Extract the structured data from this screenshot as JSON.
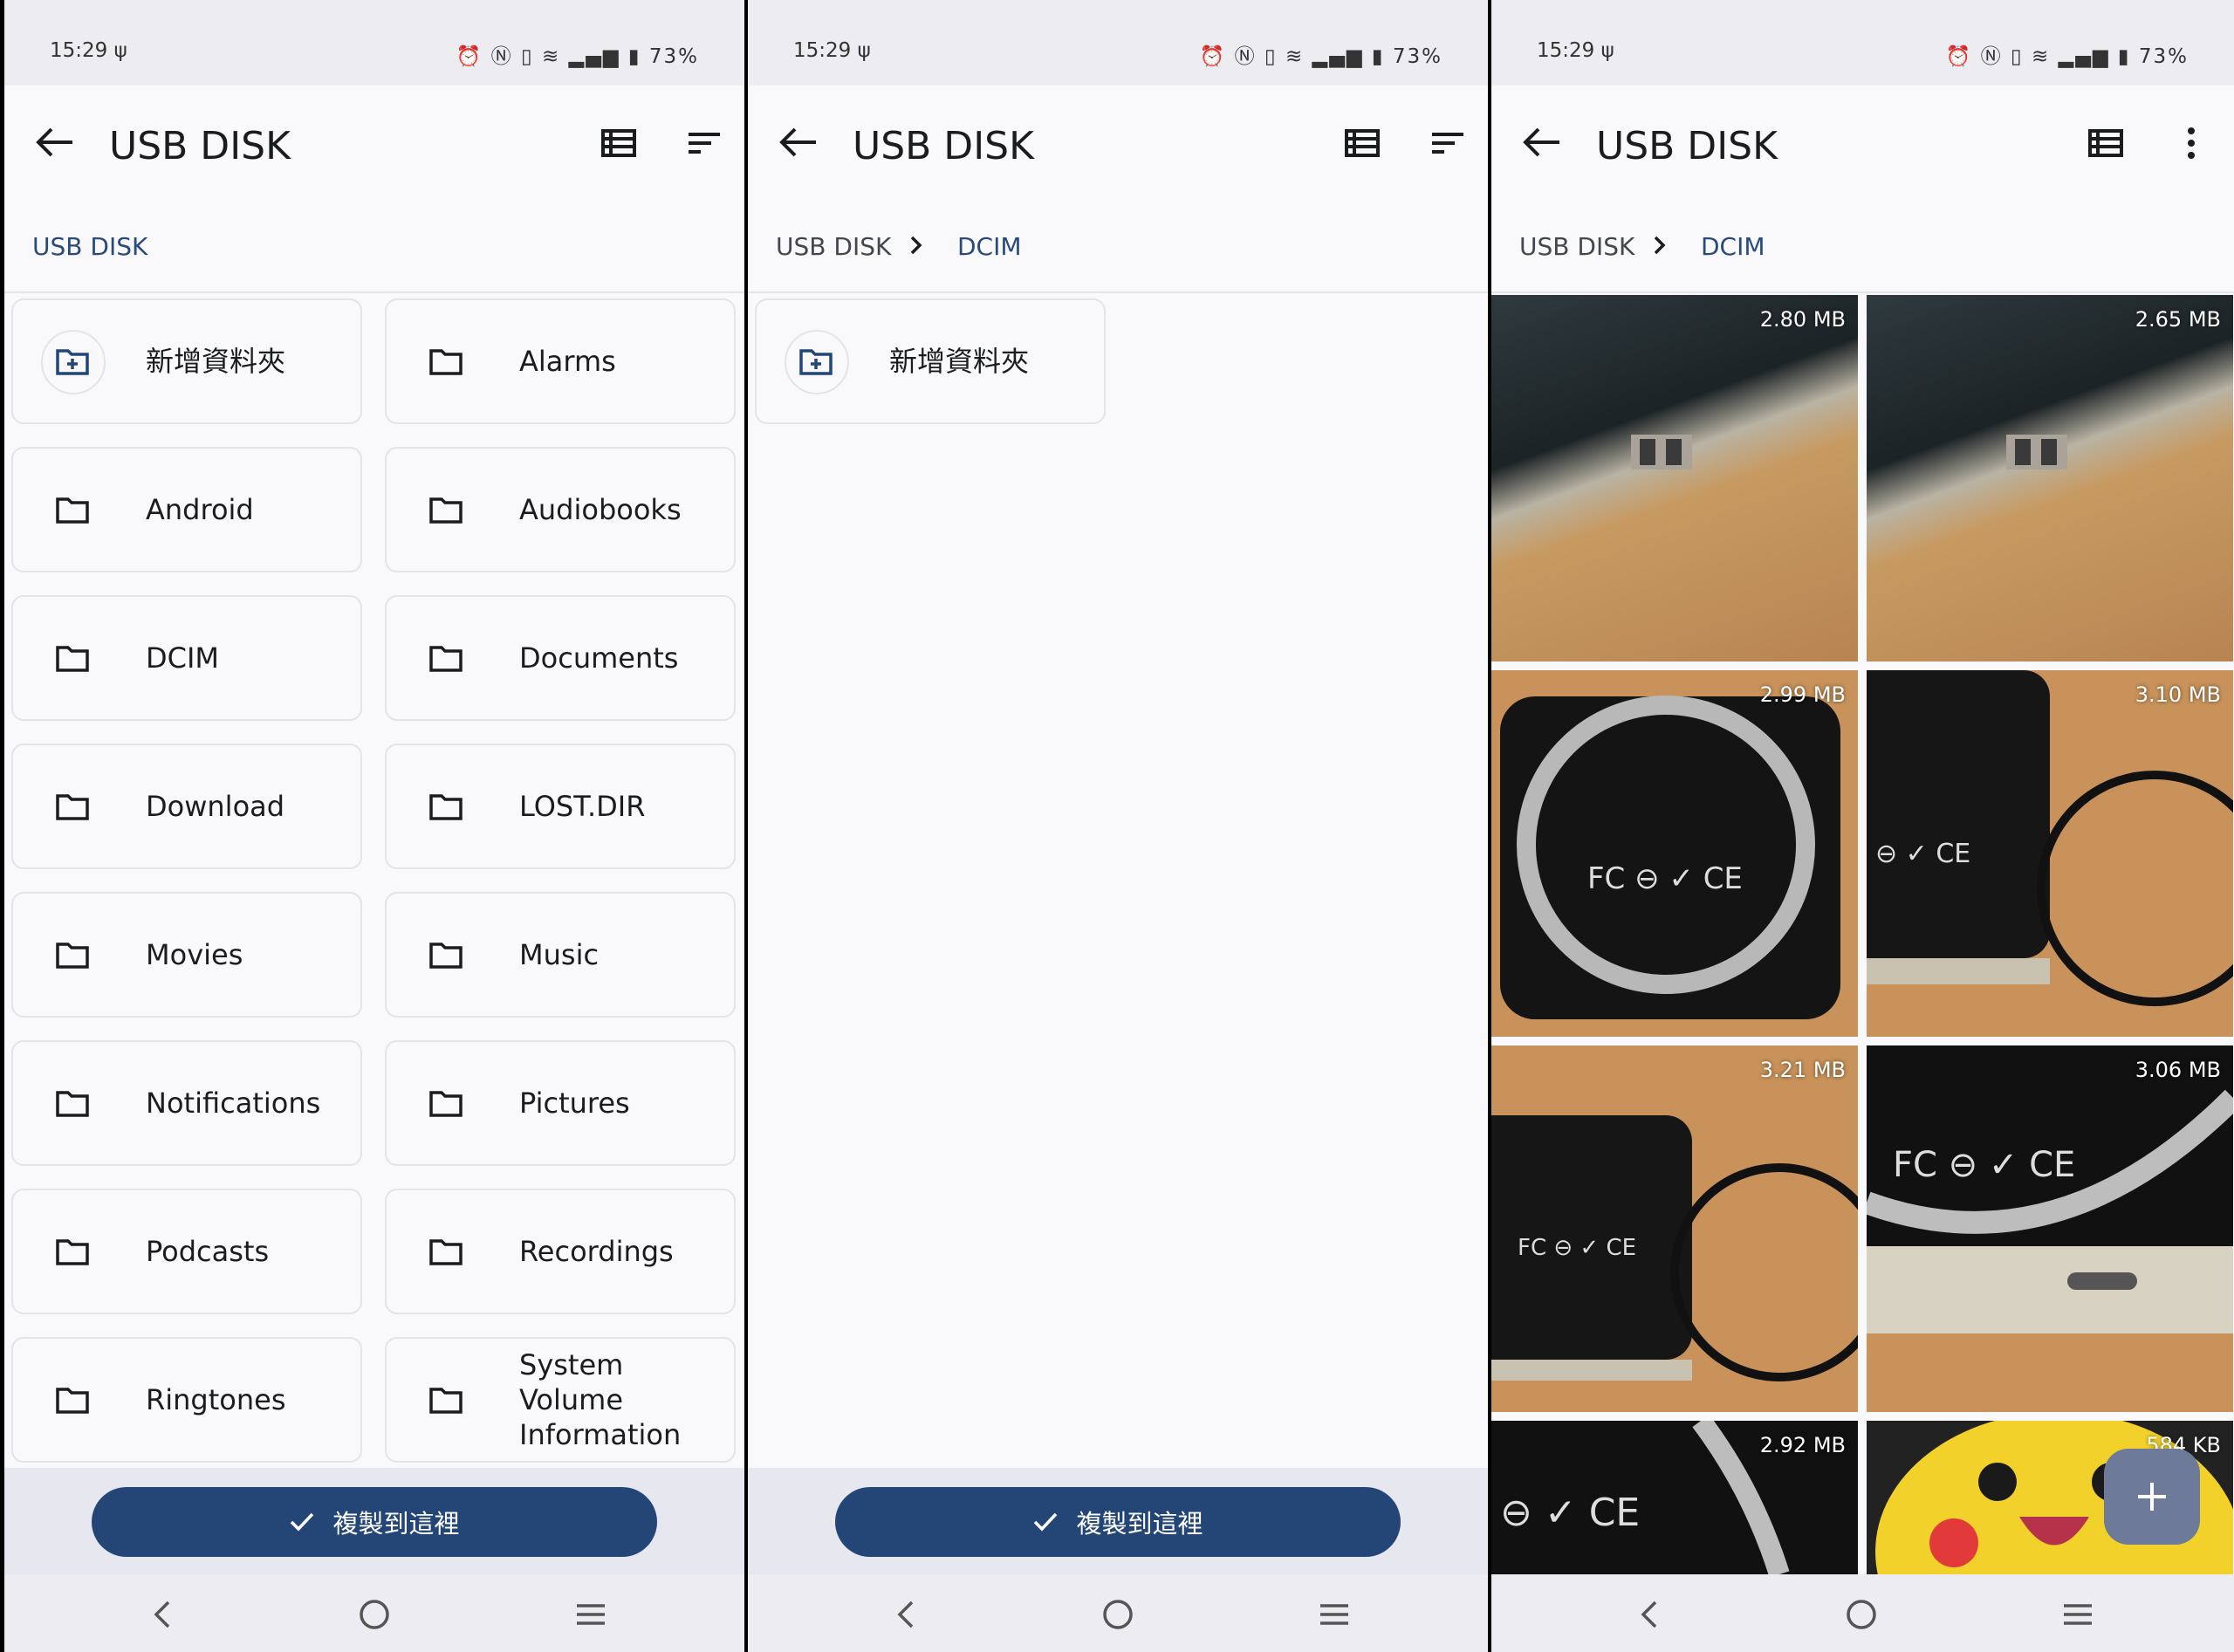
{
  "status": {
    "time": "15:29",
    "usb_glyph": "ψ",
    "battery": "73%"
  },
  "app": {
    "title": "USB DISK"
  },
  "panel1": {
    "breadcrumb": [
      "USB DISK"
    ],
    "tiles": [
      "新增資料夾",
      "Alarms",
      "Android",
      "Audiobooks",
      "DCIM",
      "Documents",
      "Download",
      "LOST.DIR",
      "Movies",
      "Music",
      "Notifications",
      "Pictures",
      "Podcasts",
      "Recordings",
      "Ringtones",
      "System Volume Information"
    ]
  },
  "panel2": {
    "breadcrumb": [
      "USB DISK",
      "DCIM"
    ],
    "tiles": [
      "新增資料夾"
    ]
  },
  "panel3": {
    "breadcrumb": [
      "USB DISK",
      "DCIM"
    ],
    "photos": [
      {
        "size": "2.80 MB",
        "subject": "drive-corner-usbc"
      },
      {
        "size": "2.65 MB",
        "subject": "drive-corner-usbc"
      },
      {
        "size": "2.99 MB",
        "subject": "drive-back-magnetic-ring"
      },
      {
        "size": "3.10 MB",
        "subject": "drive-with-ring"
      },
      {
        "size": "3.21 MB",
        "subject": "drive-with-ring"
      },
      {
        "size": "3.06 MB",
        "subject": "drive-port-closeup"
      },
      {
        "size": "2.92 MB",
        "subject": "drive-label-closeup"
      },
      {
        "size": "584 KB",
        "subject": "pikachu"
      }
    ]
  },
  "copy_button": {
    "label": "複製到這裡",
    "icon": "check-icon"
  },
  "colors": {
    "accent": "#244677",
    "breadcrumb_active": "#2a4a7a",
    "background": "#f9f9fc"
  }
}
